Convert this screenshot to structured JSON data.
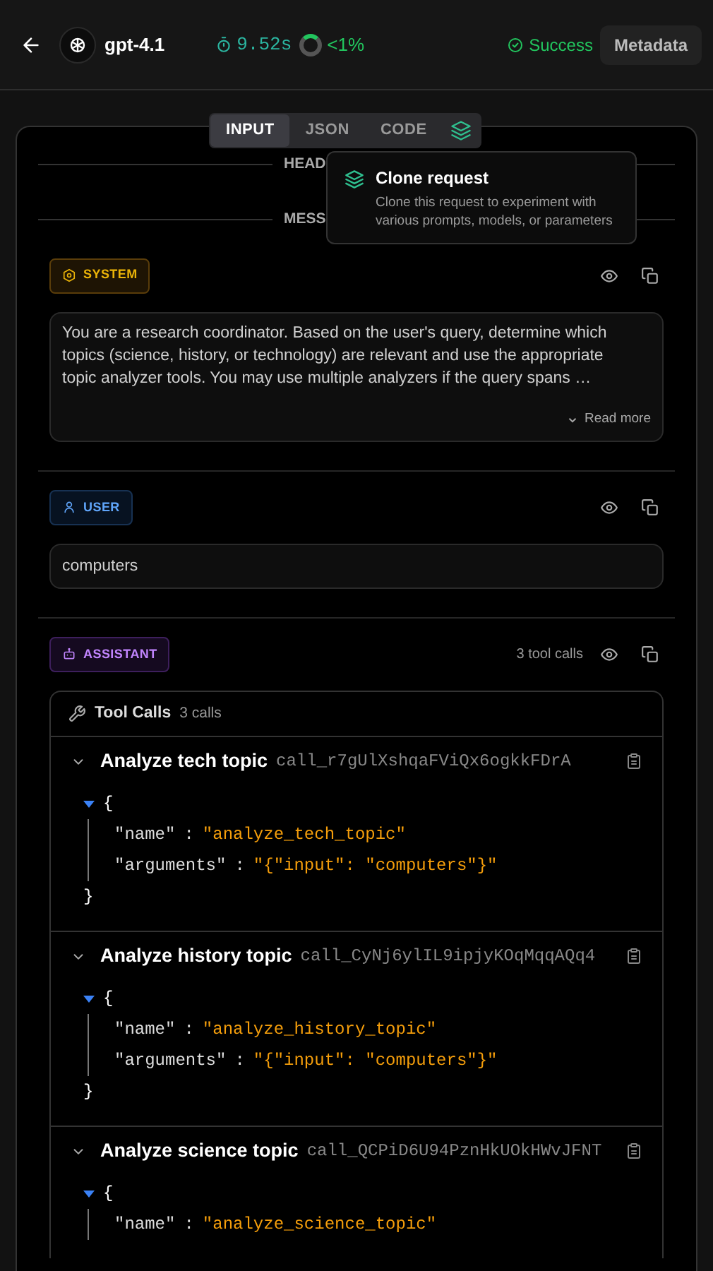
{
  "header": {
    "model": "gpt-4.1",
    "duration": "9.52s",
    "usage": "<1%",
    "status": "Success",
    "metadata_button": "Metadata"
  },
  "tabs": [
    {
      "label": "INPUT",
      "selected": true
    },
    {
      "label": "JSON",
      "selected": false
    },
    {
      "label": "CODE",
      "selected": false
    }
  ],
  "tooltip": {
    "title": "Clone request",
    "description": "Clone this request to experiment with various prompts, models, or parameters"
  },
  "sections": [
    {
      "label": "HEAD"
    },
    {
      "label": "MESS"
    }
  ],
  "messages": [
    {
      "role": "SYSTEM",
      "kind": "system",
      "text": "You are a research coordinator. Based on the user's query, determine which topics (science, history, or technology) are relevant and use the appropriate topic analyzer tools. You may use multiple analyzers if the query spans …",
      "read_more": "Read more"
    },
    {
      "role": "USER",
      "kind": "user",
      "text": "computers"
    },
    {
      "role": "ASSISTANT",
      "kind": "assistant",
      "tool_call_count": "3 tool calls",
      "tool_calls": {
        "title": "Tool Calls",
        "count": "3 calls",
        "calls": [
          {
            "name": "Analyze tech topic",
            "call_id": "call_r7gUlXshqaFViQx6ogkkFDrA",
            "expanded": true,
            "open_brace": "{",
            "fields": [
              {
                "key": "\"name\"",
                "separator": ":",
                "value": "\"analyze_tech_topic\""
              },
              {
                "key": "\"arguments\"",
                "separator": ":",
                "value": "\"{\"input\": \"computers\"}\""
              }
            ],
            "close_brace": "}"
          },
          {
            "name": "Analyze history topic",
            "call_id": "call_CyNj6ylIL9ipjyKOqMqqAQq4",
            "expanded": true,
            "open_brace": "{",
            "fields": [
              {
                "key": "\"name\"",
                "separator": ":",
                "value": "\"analyze_history_topic\""
              },
              {
                "key": "\"arguments\"",
                "separator": ":",
                "value": "\"{\"input\": \"computers\"}\""
              }
            ],
            "close_brace": "}"
          },
          {
            "name": "Analyze science topic",
            "call_id": "call_QCPiD6U94PznHkUOkHWvJFNT",
            "expanded": true,
            "open_brace": "{",
            "fields": [
              {
                "key": "\"name\"",
                "separator": ":",
                "value": "\"analyze_science_topic\""
              }
            ]
          }
        ]
      }
    }
  ]
}
